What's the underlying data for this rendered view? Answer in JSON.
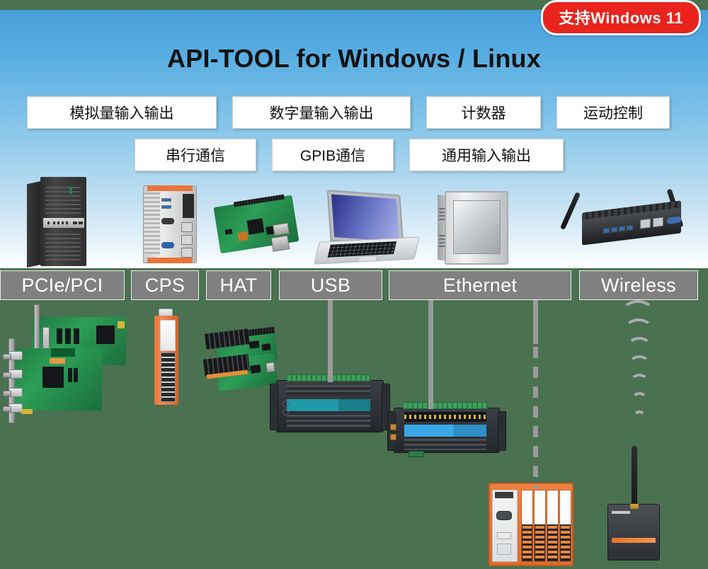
{
  "badge": {
    "text": "支持Windows 11"
  },
  "title": "API-TOOL for Windows / Linux",
  "features": {
    "row1": [
      {
        "label": "模拟量输入输出"
      },
      {
        "label": "数字量输入输出"
      },
      {
        "label": "计数器"
      },
      {
        "label": "运动控制"
      }
    ],
    "row2": [
      {
        "label": "串行通信"
      },
      {
        "label": "GPIB通信"
      },
      {
        "label": "通用输入输出"
      }
    ]
  },
  "buses": [
    {
      "label": "PCIe/PCI"
    },
    {
      "label": "CPS"
    },
    {
      "label": "HAT"
    },
    {
      "label": "USB"
    },
    {
      "label": "Ethernet"
    },
    {
      "label": "Wireless"
    }
  ],
  "hosts": [
    {
      "name": "tower-pc"
    },
    {
      "name": "cps-box-controller"
    },
    {
      "name": "raspberry-pi-board"
    },
    {
      "name": "laptop"
    },
    {
      "name": "panel-pc"
    },
    {
      "name": "wireless-gateway-pc"
    }
  ],
  "devices": [
    {
      "name": "pcie-card"
    },
    {
      "name": "pci-card"
    },
    {
      "name": "cps-io-module"
    },
    {
      "name": "hat-board-upper"
    },
    {
      "name": "hat-board-lower"
    },
    {
      "name": "usb-io-unit"
    },
    {
      "name": "ethernet-remote-io-unit"
    },
    {
      "name": "cps-plc-controller"
    },
    {
      "name": "wireless-lte-terminal"
    }
  ],
  "colors": {
    "badge_bg": "#e8241c",
    "panel_top": "#48a0db",
    "panel_bottom": "#ffffff",
    "bus_bar": "#808080",
    "page_bg": "#4a7150",
    "connector": "#9a9a9a",
    "accent_orange": "#e8743b",
    "accent_teal": "#1f9aa8",
    "accent_blue": "#3aa8e6"
  }
}
